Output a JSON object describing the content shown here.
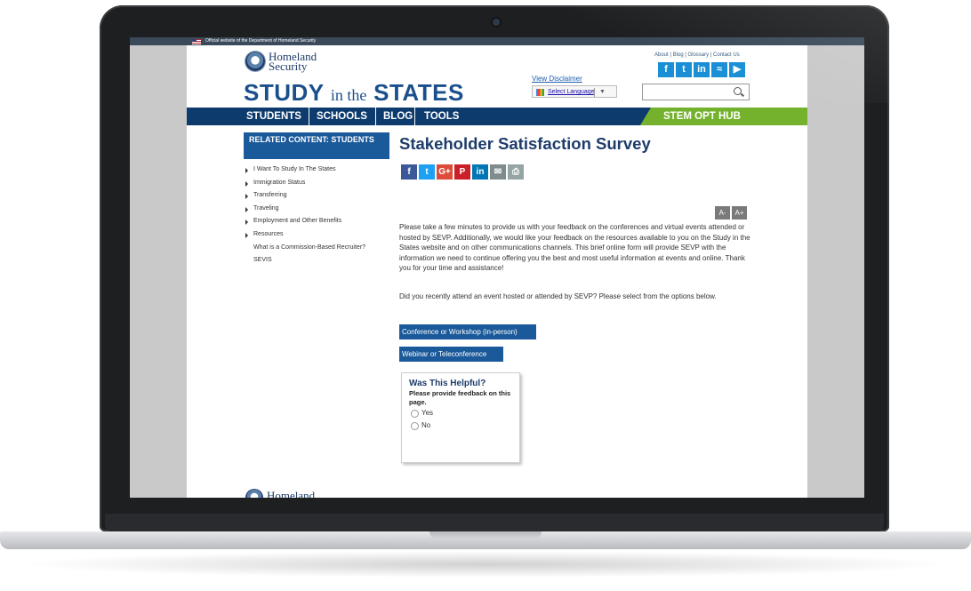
{
  "gov_banner": {
    "text": "Official website of the Department of Homeland Security"
  },
  "header": {
    "agency_line1": "Homeland",
    "agency_line2": "Security",
    "wordmark_study": "STUDY",
    "wordmark_in_the": "in the",
    "wordmark_states": "STATES",
    "top_links": "About | Blog | Glossary | Contact Us",
    "social_icons": [
      "facebook-icon",
      "twitter-icon",
      "linkedin-icon",
      "rss-icon",
      "youtube-icon"
    ],
    "social_glyphs": [
      "f",
      "t",
      "in",
      "≈",
      "▶"
    ],
    "disclaimer": "View Disclaimer",
    "translate_label": "Select Language",
    "translate_caret": "▼",
    "search_placeholder": ""
  },
  "nav": {
    "items": [
      "STUDENTS",
      "SCHOOLS",
      "BLOG",
      "TOOLS"
    ],
    "stem": "STEM OPT HUB"
  },
  "sidebar": {
    "heading": "RELATED CONTENT: STUDENTS",
    "items": [
      "I Want To Study In The States",
      "Immigration Status",
      "Transferring",
      "Traveling",
      "Employment and Other Benefits",
      "Resources"
    ],
    "subitems": [
      "What is a Commission-Based Recruiter?",
      "SEVIS"
    ]
  },
  "main": {
    "title": "Stakeholder Satisfaction Survey",
    "share_glyphs": [
      "f",
      "t",
      "G+",
      "P",
      "in",
      "✉",
      "⎙"
    ],
    "font_smaller": "A-",
    "font_larger": "A+",
    "paragraph1": "Please take a few minutes to provide us with your feedback on the conferences and virtual events attended or hosted by SEVP. Additionally, we would like your feedback on the resources available to you on the Study in the States website and on other communications channels. This brief online form will provide SEVP with the information we need to continue offering you the best and most useful information at events and online. Thank you for your time and assistance!",
    "paragraph2": "Did you recently attend an event hosted or attended by SEVP? Please select from the options below.",
    "option1": "Conference or Workshop (in-person)",
    "option2": "Webinar or Teleconference"
  },
  "feedback": {
    "title": "Was This Helpful?",
    "question": "Please provide feedback on this page.",
    "yes": "Yes",
    "no": "No"
  },
  "footer": {
    "agency": "Homeland"
  },
  "colors": {
    "nav_blue": "#0d3b6e",
    "stem_green": "#74b22e",
    "button_blue": "#1b5a9a",
    "title_navy": "#1d3c6a",
    "social_blue": "#1a8fd6"
  }
}
